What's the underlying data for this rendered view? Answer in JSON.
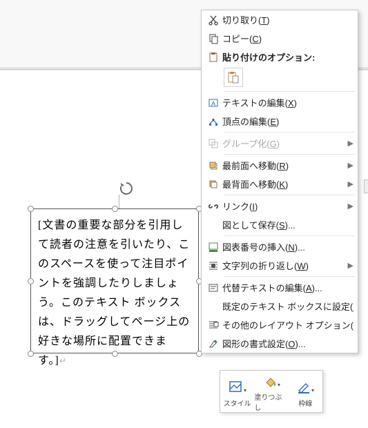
{
  "textbox": {
    "content": "[文書の重要な部分を引用して読者の注意を引いたり、このスペースを使って注目ポイントを強調したりしましょう。このテキスト ボックスは、ドラッグしてページ上の好きな場所に配置できます。]"
  },
  "menu": {
    "cut": "切り取り(T)",
    "copy": "コピー(C)",
    "paste_header": "貼り付けのオプション:",
    "edit_text": "テキストの編集(X)",
    "edit_points": "頂点の編集(E)",
    "group": "グループ化(G)",
    "bring_front": "最前面へ移動(R)",
    "send_back": "最背面へ移動(K)",
    "link": "リンク(I)",
    "save_as_pic": "図として保存(S)...",
    "insert_caption": "図表番号の挿入(N)...",
    "text_wrap": "文字列の折り返し(W)",
    "alt_text": "代替テキストの編集(A)...",
    "set_default_tb": "既定のテキスト ボックスに設定(D)",
    "more_layout": "その他のレイアウト オプション(L)...",
    "format_shape": "図形の書式設定(O)..."
  },
  "toolbar": {
    "style": "スタイル",
    "fill": "塗りつぶし",
    "outline": "枠線"
  }
}
